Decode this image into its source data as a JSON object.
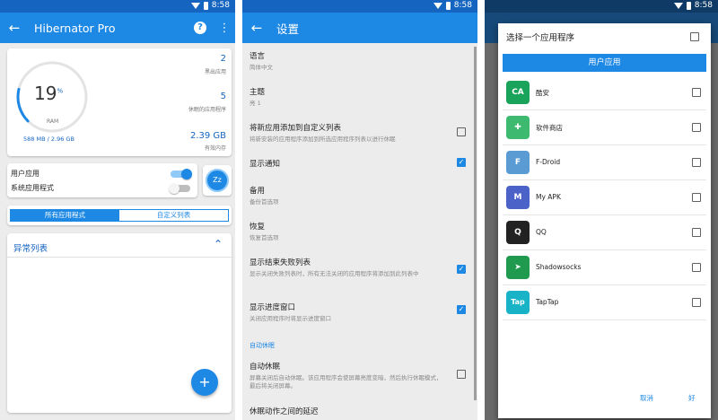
{
  "status": {
    "time": "8:58"
  },
  "colors": {
    "primary": "#1e88e5",
    "primary_dark": "#1565c0",
    "accent_green": "#1aa35a"
  },
  "panel1": {
    "appbar": {
      "back_icon": "arrow-left-icon",
      "title": "Hibernator Pro",
      "help_icon": "help-circle-icon",
      "more_icon": "more-vert-icon"
    },
    "ram": {
      "percent": 19,
      "percent_display": "19",
      "percent_sign": "%",
      "label": "RAM",
      "usage": "588 MB / 2.96 GB"
    },
    "stats": [
      {
        "value": "2",
        "label": "黑出应用"
      },
      {
        "value": "5",
        "label": "休眠的应用程序"
      },
      {
        "value": "2.39 GB",
        "label": "有效内存"
      }
    ],
    "toggles": [
      {
        "label": "用户应用",
        "on": true
      },
      {
        "label": "系统应用程式",
        "on": false
      }
    ],
    "hibernate_icon": "zzz-icon",
    "hibernate_glyph": "Zz",
    "tabs": [
      {
        "label": "所有应用程式",
        "active": true
      },
      {
        "label": "自定义列表",
        "active": false
      }
    ],
    "list_header": "异常列表",
    "list_chevron": "⌃",
    "fab_glyph": "+"
  },
  "panel2": {
    "appbar": {
      "back_icon": "arrow-left-icon",
      "title": "设置"
    },
    "items": [
      {
        "title": "语言",
        "sub": "简体中文",
        "checkbox": null
      },
      {
        "title": "主题",
        "sub": "亮 1",
        "checkbox": null
      },
      {
        "title": "将新应用添加到自定义列表",
        "sub": "将新安装的应用程序添加到所选应用程序列表以进行休眠",
        "checkbox": false
      },
      {
        "title": "显示通知",
        "sub": "",
        "checkbox": true
      },
      {
        "title": "备用",
        "sub": "备份首选项",
        "checkbox": null
      },
      {
        "title": "恢复",
        "sub": "恢复首选项",
        "checkbox": null
      },
      {
        "title": "显示结束失败列表",
        "sub": "显示关闭失败列表时，所有无法关闭的应用程序将添加到此列表中",
        "checkbox": true
      },
      {
        "title": "显示进度窗口",
        "sub": "关闭应用程序时将显示进度窗口",
        "checkbox": true
      }
    ],
    "section": "自动休眠",
    "items2": [
      {
        "title": "自动休眠",
        "sub": "屏幕关闭后自动休眠。该应用程序会使屏幕亮度变暗，然后执行休眠模式，最后将关闭屏幕。",
        "checkbox": false
      },
      {
        "title": "休眠动作之间的延迟",
        "sub": "",
        "checkbox": null
      }
    ]
  },
  "panel3": {
    "dialog_title": "选择一个应用程序",
    "header": "用户应用",
    "apps": [
      {
        "name": "酷安",
        "icon": "coolapk-icon",
        "color": "#1aa35a",
        "glyph": "CA"
      },
      {
        "name": "软件商店",
        "icon": "app-store-icon",
        "color": "#3dba6f",
        "glyph": "✚"
      },
      {
        "name": "F-Droid",
        "icon": "fdroid-icon",
        "color": "#5a9bd4",
        "glyph": "F"
      },
      {
        "name": "My APK",
        "icon": "myapk-icon",
        "color": "#4b62c9",
        "glyph": "M"
      },
      {
        "name": "QQ",
        "icon": "qq-icon",
        "color": "#222222",
        "glyph": "Q"
      },
      {
        "name": "Shadowsocks",
        "icon": "shadowsocks-icon",
        "color": "#1f9a4f",
        "glyph": "➤"
      },
      {
        "name": "TapTap",
        "icon": "taptap-icon",
        "color": "#19b3c8",
        "glyph": "Tap"
      }
    ],
    "buttons": {
      "cancel": "取消",
      "ok": "好"
    }
  }
}
